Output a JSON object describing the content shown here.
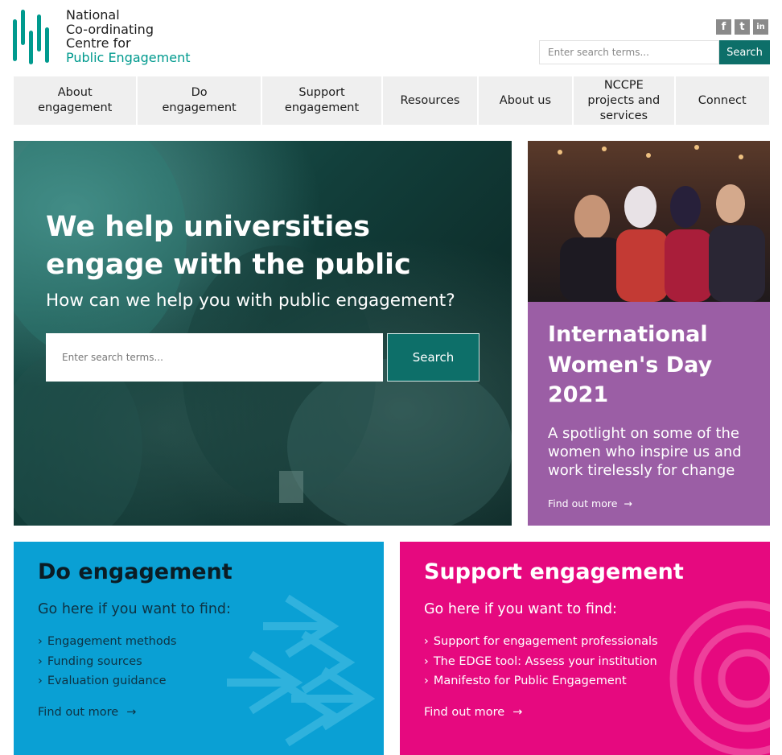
{
  "header": {
    "logo": {
      "line1": "National",
      "line2": "Co-ordinating",
      "line3": "Centre for",
      "line4": "Public Engagement"
    },
    "social": [
      {
        "icon": "facebook-icon",
        "glyph": "f"
      },
      {
        "icon": "twitter-icon",
        "glyph": "t"
      },
      {
        "icon": "linkedin-icon",
        "glyph": "in"
      }
    ],
    "search": {
      "placeholder": "Enter search terms...",
      "button": "Search"
    }
  },
  "nav": [
    {
      "label": "About engagement"
    },
    {
      "label": "Do engagement"
    },
    {
      "label": "Support engagement"
    },
    {
      "label": "Resources"
    },
    {
      "label": "About us"
    },
    {
      "label": "NCCPE projects and services"
    },
    {
      "label": "Connect"
    }
  ],
  "hero": {
    "title": "We help universities engage with the public",
    "subtitle": "How can we help you with public engagement?",
    "search": {
      "placeholder": "Enter search terms...",
      "button": "Search"
    }
  },
  "feature": {
    "title": "International Women's Day 2021",
    "description": "A spotlight on some of the women who inspire us and work tirelessly for change",
    "link": "Find out more"
  },
  "panels": {
    "do": {
      "title": "Do engagement",
      "subtitle": "Go here if you want to find:",
      "items": [
        "Engagement methods",
        "Funding sources",
        "Evaluation guidance"
      ],
      "link": "Find out more"
    },
    "support": {
      "title": "Support engagement",
      "subtitle": "Go here if you want to find:",
      "items": [
        "Support for engagement professionals",
        "The EDGE tool: Assess your institution",
        "Manifesto for Public Engagement"
      ],
      "link": "Find out more"
    }
  },
  "colors": {
    "brand_teal": "#009a8e",
    "button_teal": "#0d6f69",
    "feature_purple": "#9b5ea5",
    "do_blue": "#0aa0d4",
    "support_pink": "#e6097f",
    "nav_bg": "#efefef"
  }
}
